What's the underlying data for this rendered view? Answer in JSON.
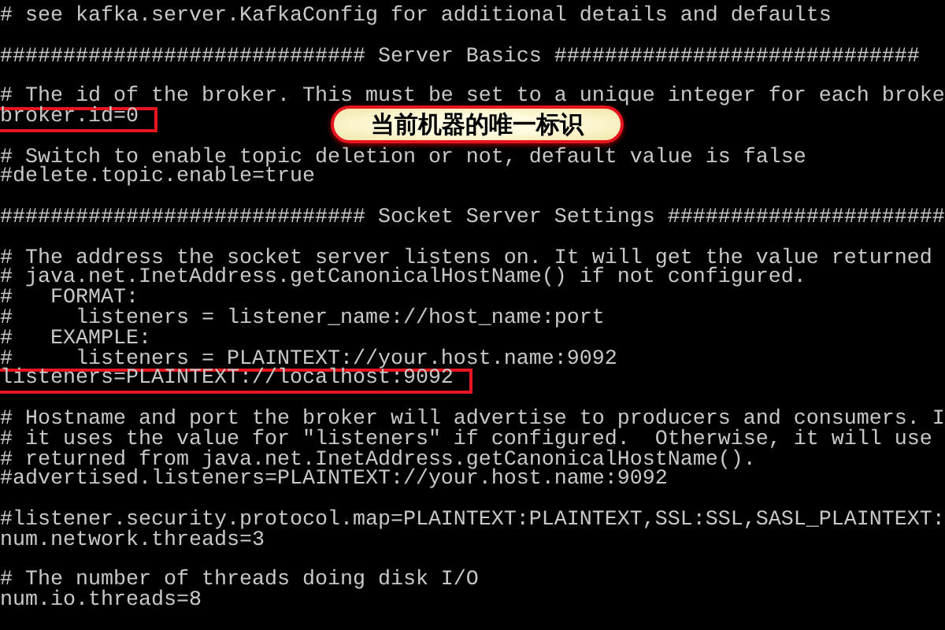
{
  "lines": [
    {
      "kind": "text",
      "text": "# see kafka.server.KafkaConfig for additional details and defaults",
      "highlighted": false
    },
    {
      "kind": "blank"
    },
    {
      "kind": "text",
      "text": "############################# Server Basics #############################",
      "highlighted": false
    },
    {
      "kind": "blank"
    },
    {
      "kind": "text",
      "text": "# The id of the broker. This must be set to a unique integer for each broke",
      "highlighted": false
    },
    {
      "kind": "text",
      "text": "broker.id=0",
      "highlighted": true
    },
    {
      "kind": "blank"
    },
    {
      "kind": "text",
      "text": "# Switch to enable topic deletion or not, default value is false",
      "highlighted": false
    },
    {
      "kind": "text",
      "text": "#delete.topic.enable=true",
      "highlighted": false
    },
    {
      "kind": "blank"
    },
    {
      "kind": "text",
      "text": "############################# Socket Server Settings ######################",
      "highlighted": false
    },
    {
      "kind": "blank"
    },
    {
      "kind": "text",
      "text": "# The address the socket server listens on. It will get the value returned",
      "highlighted": false
    },
    {
      "kind": "text",
      "text": "# java.net.InetAddress.getCanonicalHostName() if not configured.",
      "highlighted": false
    },
    {
      "kind": "text",
      "text": "#   FORMAT:",
      "highlighted": false
    },
    {
      "kind": "text",
      "text": "#     listeners = listener_name://host_name:port",
      "highlighted": false
    },
    {
      "kind": "text",
      "text": "#   EXAMPLE:",
      "highlighted": false
    },
    {
      "kind": "text",
      "text": "#     listeners = PLAINTEXT://your.host.name:9092",
      "highlighted": false
    },
    {
      "kind": "text",
      "text": "listeners=PLAINTEXT://localhost:9092",
      "highlighted": true
    },
    {
      "kind": "blank"
    },
    {
      "kind": "text",
      "text": "# Hostname and port the broker will advertise to producers and consumers. I",
      "highlighted": false
    },
    {
      "kind": "text",
      "text": "# it uses the value for \"listeners\" if configured.  Otherwise, it will use",
      "highlighted": false
    },
    {
      "kind": "text",
      "text": "# returned from java.net.InetAddress.getCanonicalHostName().",
      "highlighted": false
    },
    {
      "kind": "text",
      "text": "#advertised.listeners=PLAINTEXT://your.host.name:9092",
      "highlighted": false
    },
    {
      "kind": "blank"
    },
    {
      "kind": "text",
      "text": "#listener.security.protocol.map=PLAINTEXT:PLAINTEXT,SSL:SSL,SASL_PLAINTEXT:",
      "highlighted": false
    },
    {
      "kind": "text",
      "text": "num.network.threads=3",
      "highlighted": false
    },
    {
      "kind": "blank"
    },
    {
      "kind": "text",
      "text": "# The number of threads doing disk I/O",
      "highlighted": false
    },
    {
      "kind": "text",
      "text": "num.io.threads=8",
      "highlighted": false
    }
  ],
  "callout": {
    "text": "当前机器的唯一标识"
  }
}
